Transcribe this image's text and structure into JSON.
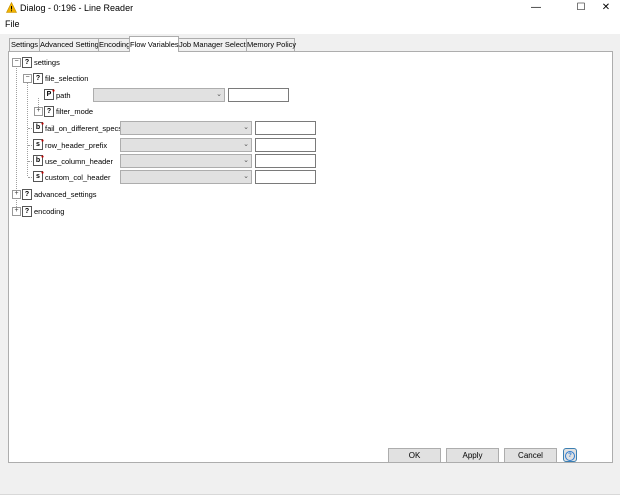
{
  "window": {
    "title": "Dialog - 0:196 - Line Reader",
    "minimize": "—",
    "maximize": "☐",
    "close": "✕"
  },
  "menu": {
    "file": "File"
  },
  "tabs": [
    {
      "label": "Settings"
    },
    {
      "label": "Advanced Settings"
    },
    {
      "label": "Encoding"
    },
    {
      "label": "Flow Variables",
      "active": true
    },
    {
      "label": "Job Manager Selection"
    },
    {
      "label": "Memory Policy"
    }
  ],
  "tree": {
    "settings": "settings",
    "file_selection": "file_selection",
    "path": "path",
    "filter_mode": "filter_mode",
    "fail_on_different_specs": "fail_on_different_specs",
    "row_header_prefix": "row_header_prefix",
    "use_column_header": "use_column_header",
    "custom_col_header": "custom_col_header",
    "advanced_settings": "advanced_settings",
    "encoding": "encoding",
    "expanded_glyph": "−",
    "collapsed_glyph": "+",
    "unknown_icon": "?",
    "type_path": "P",
    "type_boolean": "b",
    "type_string": "s"
  },
  "buttons": {
    "ok": "OK",
    "apply": "Apply",
    "cancel": "Cancel",
    "help": "?"
  },
  "colors": {
    "warning_icon": "#f2b300",
    "help_accent": "#2d7cd1"
  }
}
